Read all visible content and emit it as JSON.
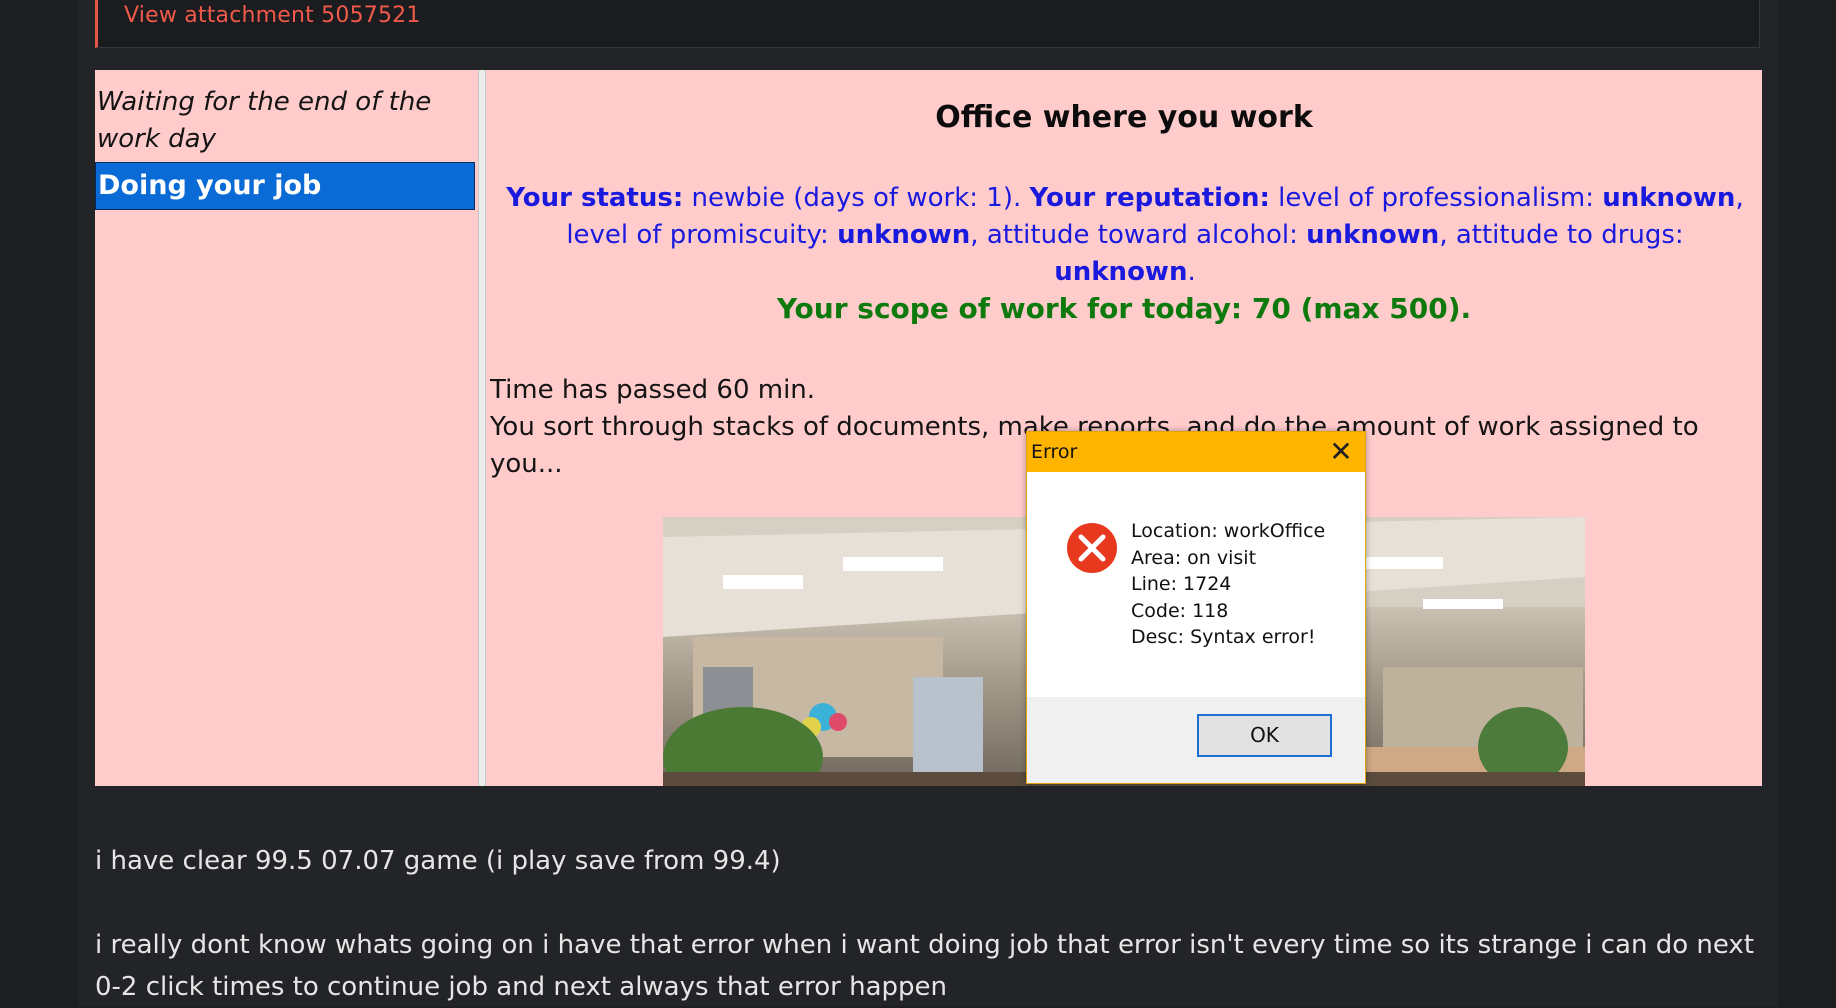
{
  "attachment": {
    "link_text": "View attachment 5057521"
  },
  "game": {
    "sidebar": {
      "items": [
        {
          "label": "Waiting for the end of the work day",
          "selected": false
        },
        {
          "label": "Doing your job",
          "selected": true
        }
      ]
    },
    "title": "Office where you work",
    "status": {
      "status_label": "Your status:",
      "status_value": " newbie (days of work: 1).  ",
      "reputation_label": "Your reputation:",
      "prof_text": " level of professionalism: ",
      "prof_value": "unknown",
      "prom_text": ", level of promiscuity: ",
      "prom_value": "unknown",
      "alcohol_text": ", attitude toward alcohol: ",
      "alcohol_value": "unknown",
      "drugs_text": ", attitude to drugs: ",
      "drugs_value": "unknown",
      "end": "."
    },
    "scope": "Your scope of work for today: 70 (max 500).",
    "time_line": "Time has passed 60 min.",
    "work_line": "You sort through stacks of documents, make reports, and do the amount of work assigned to you..."
  },
  "error_dialog": {
    "title": "Error",
    "close_glyph": "✕",
    "lines": [
      "Location: workOffice",
      "Area: on visit",
      "Line: 1724",
      "Code: 118",
      "Desc: Syntax error!"
    ],
    "ok_label": "OK"
  },
  "post": {
    "paragraph1": "i have clear 99.5 07.07 game (i play save from 99.4)",
    "paragraph2": "i really dont know whats going on i have that error when i want doing job that error isn't every time so its strange i can do next 0-2 click times to continue job and next always that error happen"
  },
  "colors": {
    "accent_link": "#f15a4a",
    "game_bg": "#ffcbcb",
    "status_blue": "#1a1adf",
    "scope_green": "#0e7a0e",
    "dialog_titlebar": "#ffb400",
    "selected_item": "#0a6ad6"
  }
}
